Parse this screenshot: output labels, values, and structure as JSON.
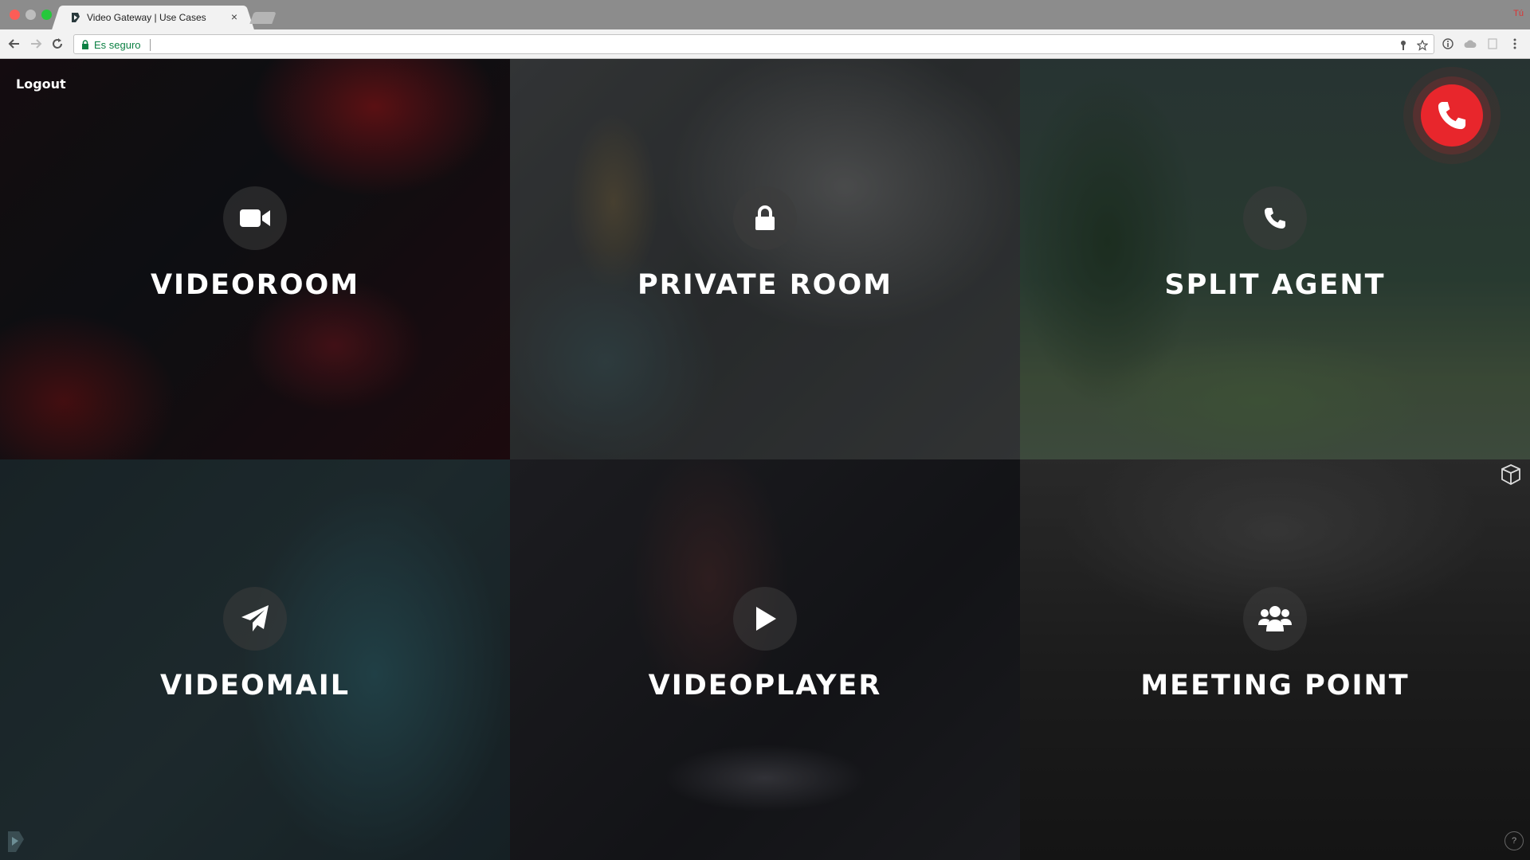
{
  "browser": {
    "tab_title": "Video Gateway | Use Cases",
    "tab_close": "×",
    "profile_label": "Tú",
    "security_label": "Es seguro"
  },
  "app": {
    "logout_label": "Logout",
    "help_label": "?",
    "accent_color": "#e8262c",
    "tiles": [
      {
        "label": "VIDEOROOM",
        "icon": "video-camera-icon"
      },
      {
        "label": "PRIVATE ROOM",
        "icon": "lock-icon"
      },
      {
        "label": "SPLIT AGENT",
        "icon": "phone-icon"
      },
      {
        "label": "VIDEOMAIL",
        "icon": "paper-plane-icon"
      },
      {
        "label": "VIDEOPLAYER",
        "icon": "play-icon"
      },
      {
        "label": "MEETING POINT",
        "icon": "group-icon"
      }
    ]
  }
}
